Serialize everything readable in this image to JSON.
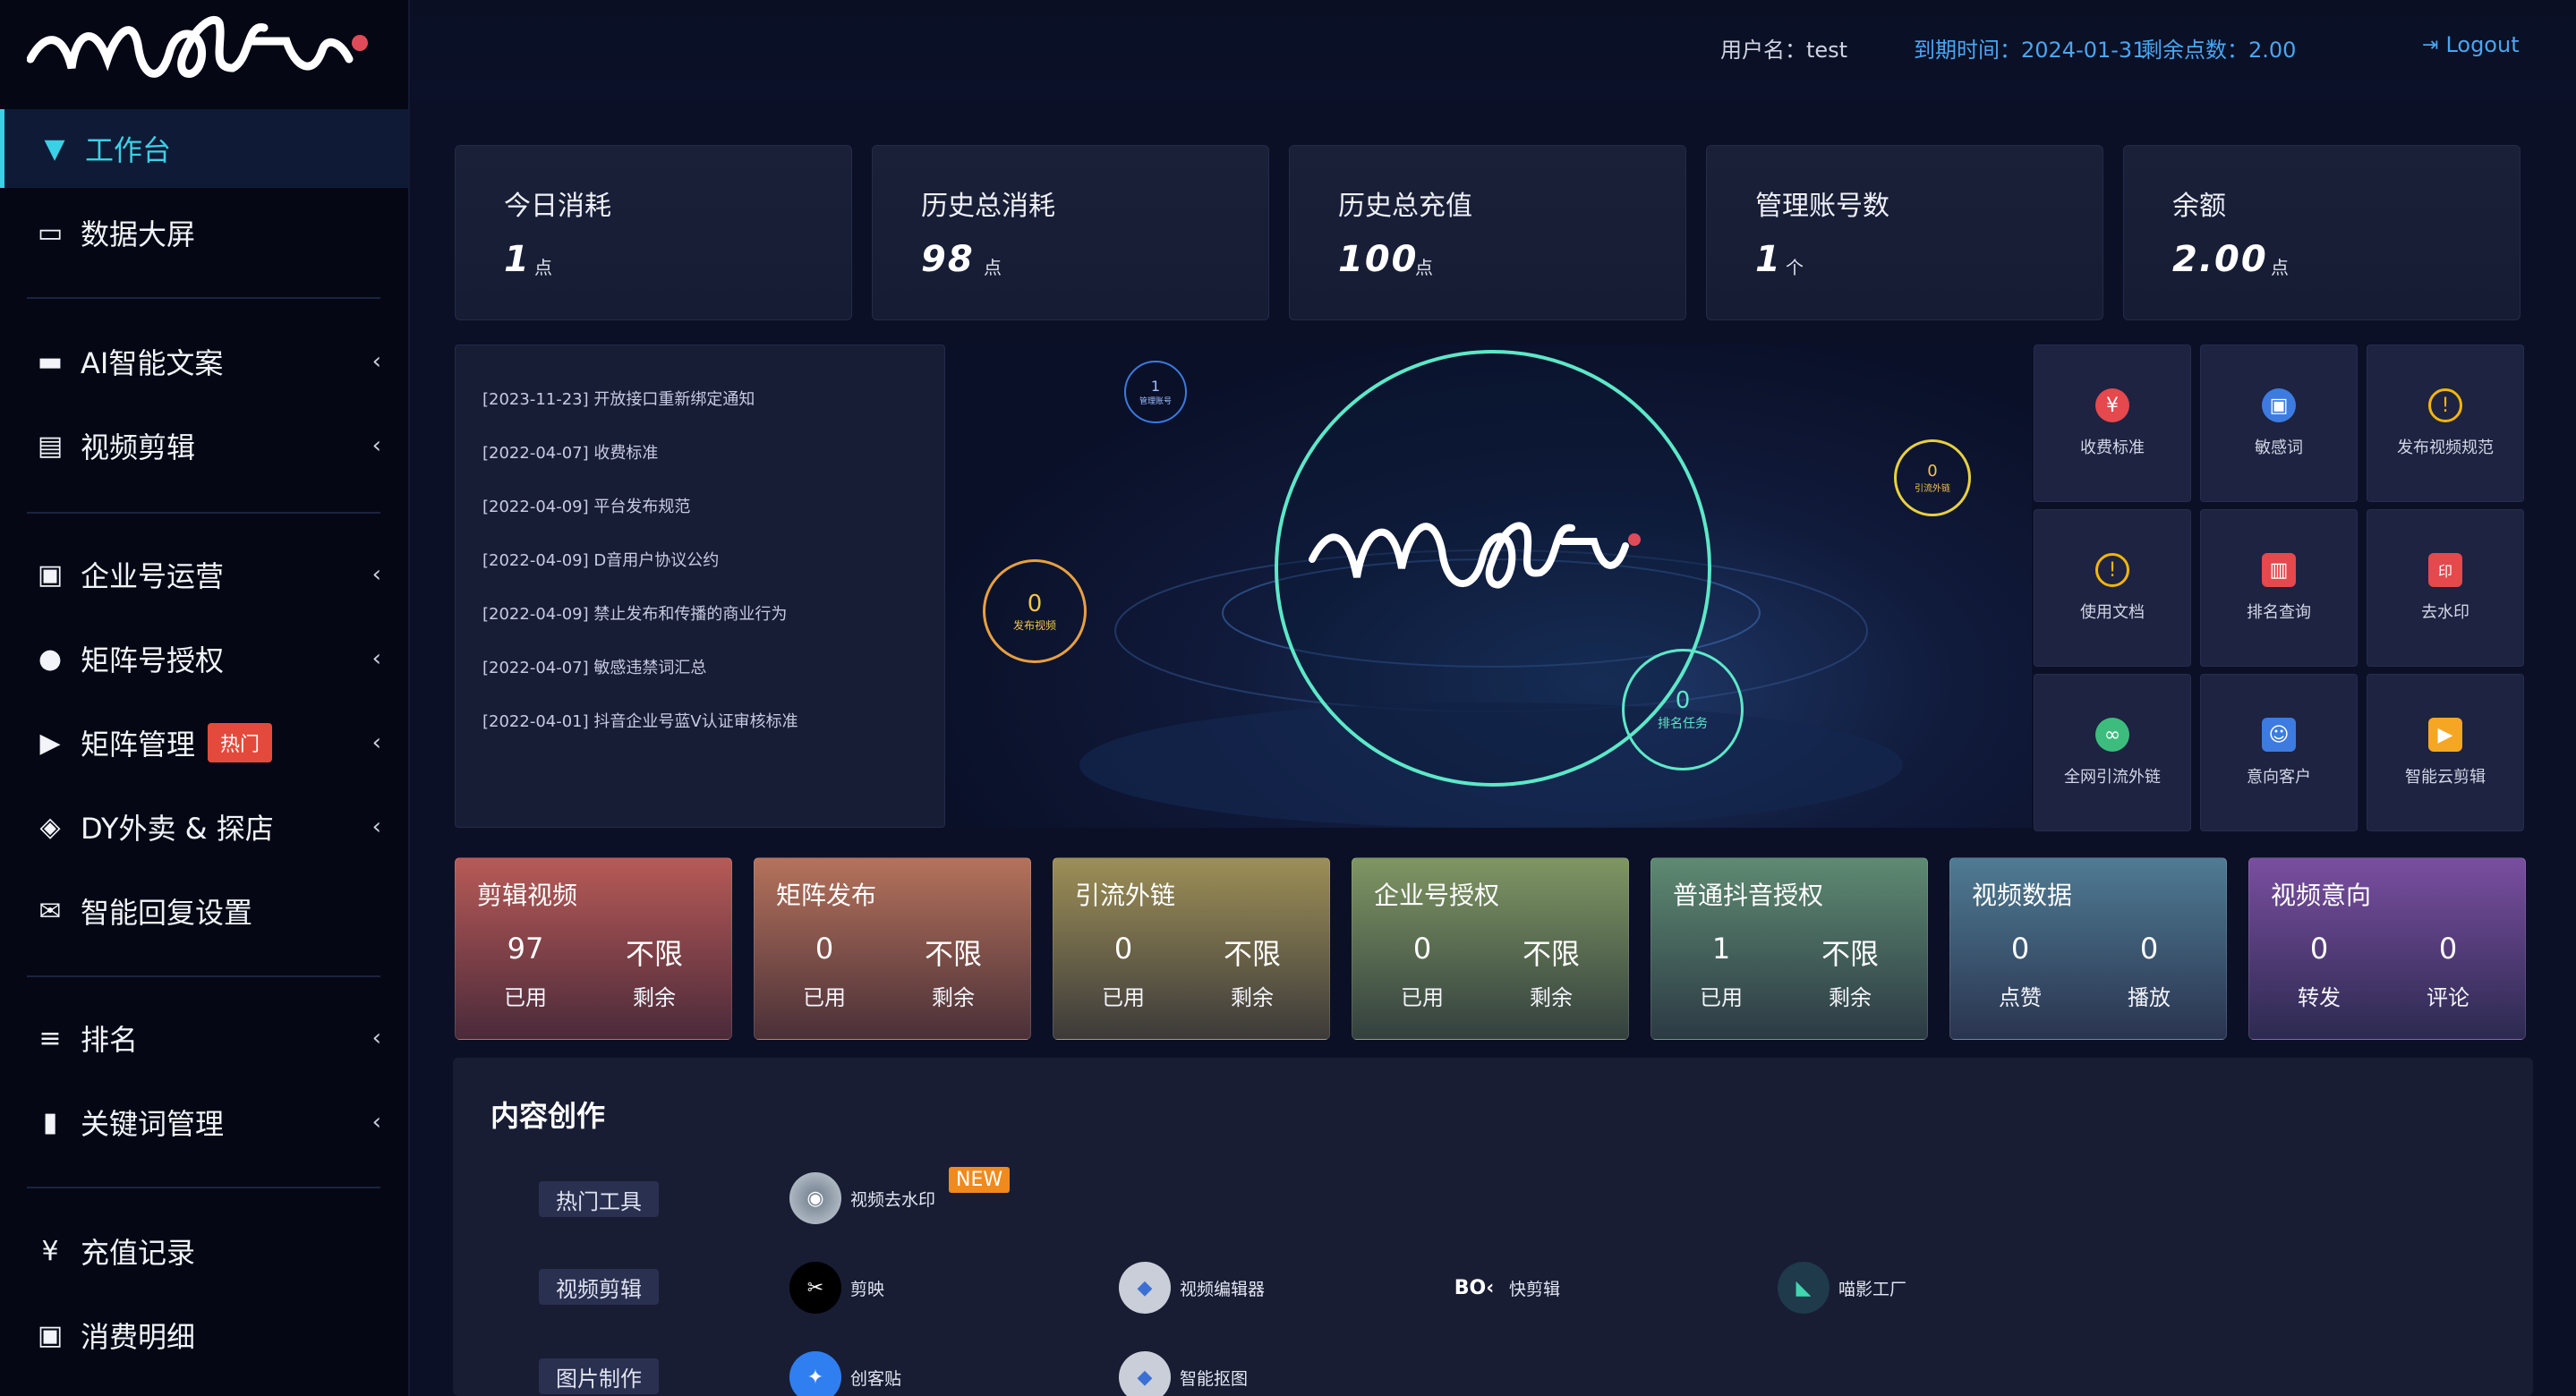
{
  "header": {
    "username_label": "用户名：test",
    "expiry_label": "到期时间：2024-01-31",
    "points_label": "剩余点数：2.00",
    "logout": "Logout"
  },
  "sidebar": {
    "items": [
      {
        "label": "工作台",
        "icon": "filter-icon"
      },
      {
        "label": "数据大屏",
        "icon": "laptop-icon"
      },
      {
        "label": "AI智能文案",
        "icon": "folder-icon"
      },
      {
        "label": "视频剪辑",
        "icon": "film-icon"
      },
      {
        "label": "企业号运营",
        "icon": "window-icon"
      },
      {
        "label": "矩阵号授权",
        "icon": "user-circle-icon"
      },
      {
        "label": "矩阵管理",
        "icon": "play-square-icon",
        "badge": "热门"
      },
      {
        "label": "DY外卖 & 探店",
        "icon": "share-icon"
      },
      {
        "label": "智能回复设置",
        "icon": "envelope-icon"
      },
      {
        "label": "排名",
        "icon": "list-icon"
      },
      {
        "label": "关键词管理",
        "icon": "file-icon"
      },
      {
        "label": "充值记录",
        "icon": "yen-icon"
      },
      {
        "label": "消费明细",
        "icon": "money-icon"
      }
    ]
  },
  "stats": [
    {
      "label": "今日消耗",
      "value": "1",
      "unit": "点"
    },
    {
      "label": "历史总消耗",
      "value": "98",
      "unit": "点"
    },
    {
      "label": "历史总充值",
      "value": "100",
      "unit": "点"
    },
    {
      "label": "管理账号数",
      "value": "1",
      "unit": "个"
    },
    {
      "label": "余额",
      "value": "2.00",
      "unit": "点"
    }
  ],
  "notices": [
    "[2023-11-23] 开放接口重新绑定通知",
    "[2022-04-07] 收费标准",
    "[2022-04-09] 平台发布规范",
    "[2022-04-09] D音用户协议公约",
    "[2022-04-09] 禁止发布和传播的商业行为",
    "[2022-04-07] 敏感违禁词汇总",
    "[2022-04-01] 抖音企业号蓝V认证审核标准"
  ],
  "hero": {
    "orbs": [
      {
        "num": "1",
        "txt": "管理账号"
      },
      {
        "num": "0",
        "txt": "引流外链"
      },
      {
        "num": "0",
        "txt": "发布视频"
      },
      {
        "num": "0",
        "txt": "排名任务"
      }
    ]
  },
  "tiles": [
    {
      "label": "收费标准",
      "icon": "yen-circle-icon",
      "color": "#e5484d"
    },
    {
      "label": "敏感词",
      "icon": "briefcase-icon",
      "color": "#3d7be0"
    },
    {
      "label": "发布视频规范",
      "icon": "warning-circle-icon",
      "color": "#f5b50a"
    },
    {
      "label": "使用文档",
      "icon": "warning-circle-icon",
      "color": "#f5b50a"
    },
    {
      "label": "排名查询",
      "icon": "bar-chart-icon",
      "color": "#e5484d"
    },
    {
      "label": "去水印",
      "icon": "watermark-icon",
      "color": "#e5484d"
    },
    {
      "label": "全网引流外链",
      "icon": "link-icon",
      "color": "#3dbd7d"
    },
    {
      "label": "意向客户",
      "icon": "contact-icon",
      "color": "#3d7be0"
    },
    {
      "label": "智能云剪辑",
      "icon": "video-icon",
      "color": "#f5a623"
    }
  ],
  "quotas": [
    {
      "title": "剪辑视频",
      "v1": "97",
      "l1": "已用",
      "v2": "不限",
      "l2": "剩余",
      "color": "#b85a57"
    },
    {
      "title": "矩阵发布",
      "v1": "0",
      "l1": "已用",
      "v2": "不限",
      "l2": "剩余",
      "color": "#b5725b"
    },
    {
      "title": "引流外链",
      "v1": "0",
      "l1": "已用",
      "v2": "不限",
      "l2": "剩余",
      "color": "#9d8f57"
    },
    {
      "title": "企业号授权",
      "v1": "0",
      "l1": "已用",
      "v2": "不限",
      "l2": "剩余",
      "color": "#7f9663"
    },
    {
      "title": "普通抖音授权",
      "v1": "1",
      "l1": "已用",
      "v2": "不限",
      "l2": "剩余",
      "color": "#5e8a72"
    },
    {
      "title": "视频数据",
      "v1": "0",
      "l1": "点赞",
      "v2": "0",
      "l2": "播放",
      "color": "#4f7b93"
    },
    {
      "title": "视频意向",
      "v1": "0",
      "l1": "转发",
      "v2": "0",
      "l2": "评论",
      "color": "#7a4ea0"
    }
  ],
  "content": {
    "title": "内容创作",
    "categories": [
      "热门工具",
      "视频剪辑",
      "图片制作"
    ],
    "tools": {
      "hot": [
        {
          "label": "视频去水印",
          "icon": "watermark-remover-icon",
          "badge": "NEW"
        }
      ],
      "video": [
        {
          "label": "剪映",
          "icon": "capcut-icon"
        },
        {
          "label": "视频编辑器",
          "icon": "video-editor-icon"
        },
        {
          "label": "快剪辑",
          "icon": "kuaijianji-icon"
        },
        {
          "label": "喵影工厂",
          "icon": "miaoying-icon"
        }
      ],
      "image": [
        {
          "label": "创客贴",
          "icon": "chuangketie-icon"
        },
        {
          "label": "智能抠图",
          "icon": "smart-cutout-icon"
        }
      ]
    }
  }
}
